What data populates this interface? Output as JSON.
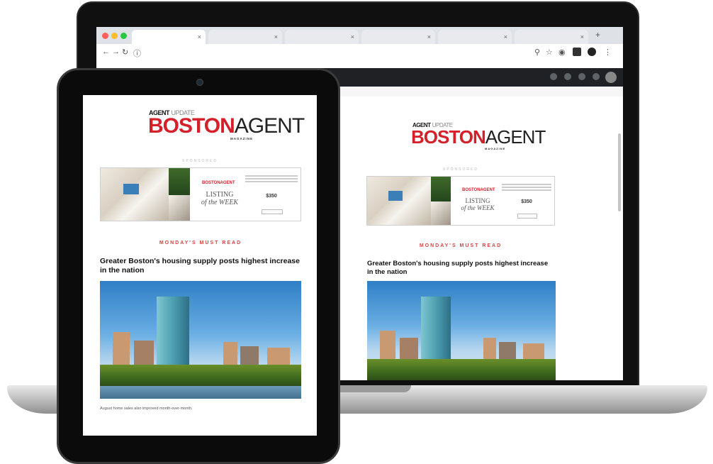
{
  "newsletter": {
    "logo": {
      "agent": "AGENT",
      "update": "UPDATE",
      "boston": "BOSTON",
      "agent_large": "AGENT",
      "magazine": "MAGAZINE"
    },
    "sponsor_label": "SPONSORED",
    "ad": {
      "brand": "BOSTONAGENT",
      "listing_line1": "LISTING",
      "listing_line2": "of the WEEK",
      "price": "$350"
    },
    "section_label": "MONDAY'S MUST READ",
    "headline": "Greater Boston's housing supply posts highest increase in the nation",
    "caption": "August home sales also improved month-over-month."
  },
  "browser": {
    "colors": {
      "close": "#ff5f57",
      "minimize": "#febc2e",
      "maximize": "#28c840"
    },
    "icons": [
      "back-icon",
      "forward-icon",
      "reload-icon",
      "info-icon",
      "search-icon",
      "star-icon",
      "extension-icon",
      "profile-icon",
      "menu-icon"
    ]
  },
  "colors": {
    "brand_red": "#d4202a",
    "section_red": "#d64545"
  }
}
